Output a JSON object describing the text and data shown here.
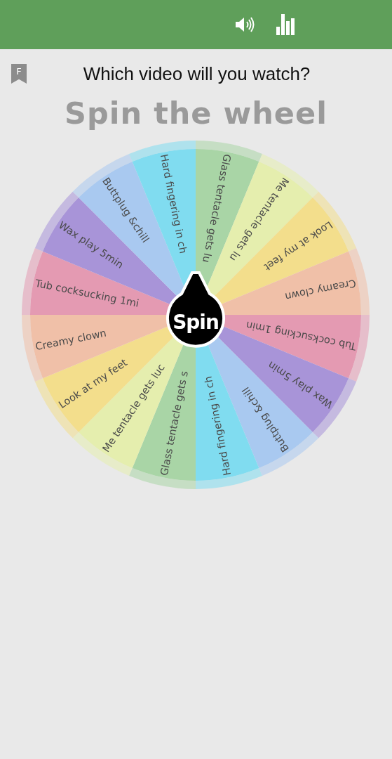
{
  "bookmark": {
    "letter": "F"
  },
  "question": "Which video will you watch?",
  "title": "Spin the wheel",
  "wheel": {
    "segments": [
      {
        "label": "Glass tentacle gets lu",
        "color": "#a9d5a6"
      },
      {
        "label": "Me tentacle gets lu",
        "color": "#e5eeae"
      },
      {
        "label": "Look at my feet",
        "color": "#f3de8c"
      },
      {
        "label": "Creamy clown",
        "color": "#f0c0a8"
      },
      {
        "label": "Tub cocksucking 1min",
        "color": "#e49ab2"
      },
      {
        "label": "Wax play 5min",
        "color": "#a894d8"
      },
      {
        "label": "Buttplug &chill",
        "color": "#a9c9f0"
      },
      {
        "label": "Hard fingering in ch",
        "color": "#80dcf0"
      },
      {
        "label": "Glass tentacle gets s",
        "color": "#a9d5a6"
      },
      {
        "label": "Me tentacle gets luc",
        "color": "#e5eeae"
      },
      {
        "label": "Look at my feet",
        "color": "#f3de8c"
      },
      {
        "label": "Creamy clown",
        "color": "#f0c0a8"
      },
      {
        "label": "Tub cocksucking 1mi",
        "color": "#e49ab2"
      },
      {
        "label": "Wax play 5min",
        "color": "#a894d8"
      },
      {
        "label": "Buttplug &chill",
        "color": "#a9c9f0"
      },
      {
        "label": "Hard fingering in ch",
        "color": "#80dcf0"
      }
    ],
    "button": "Spin"
  }
}
